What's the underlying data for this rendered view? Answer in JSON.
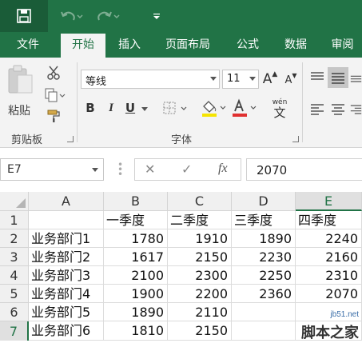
{
  "colors": {
    "accent": "#217346",
    "ribbon": "#f3f3f3",
    "underline_color": "#e03030",
    "fill_color": "#f5e400"
  },
  "tabs": [
    {
      "label": "文件",
      "active": false
    },
    {
      "label": "开始",
      "active": true
    },
    {
      "label": "插入",
      "active": false
    },
    {
      "label": "页面布局",
      "active": false
    },
    {
      "label": "公式",
      "active": false
    },
    {
      "label": "数据",
      "active": false
    },
    {
      "label": "审阅",
      "active": false
    }
  ],
  "ribbon": {
    "clipboard": {
      "paste_label": "粘贴",
      "group_label": "剪贴板"
    },
    "font": {
      "name": "等线",
      "size": "11",
      "bold": "B",
      "italic": "I",
      "underline": "U",
      "grow": "A",
      "shrink": "A",
      "phonetic": "wén",
      "phonetic_char": "文",
      "group_label": "字体"
    }
  },
  "formula_bar": {
    "name_box": "E7",
    "cancel": "✕",
    "enter": "✓",
    "fx": "fx",
    "content": "2070"
  },
  "sheet": {
    "columns": [
      "A",
      "B",
      "C",
      "D",
      "E"
    ],
    "rows": [
      "1",
      "2",
      "3",
      "4",
      "5",
      "6",
      "7"
    ],
    "data": [
      [
        "",
        "一季度",
        "二季度",
        "三季度",
        "四季度"
      ],
      [
        "业务部门1",
        "1780",
        "1910",
        "1890",
        "2240"
      ],
      [
        "业务部门2",
        "1617",
        "2150",
        "2230",
        "2160"
      ],
      [
        "业务部门3",
        "2100",
        "2300",
        "2250",
        "2310"
      ],
      [
        "业务部门4",
        "1900",
        "2200",
        "2360",
        "2070"
      ],
      [
        "业务部门5",
        "1890",
        "2110",
        "",
        ""
      ],
      [
        "业务部门6",
        "1810",
        "2150",
        "",
        ""
      ]
    ]
  },
  "watermark": {
    "url": "jb51.net",
    "text": "脚本之家"
  }
}
